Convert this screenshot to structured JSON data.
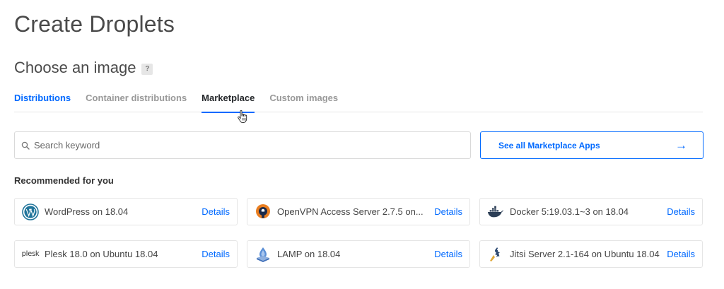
{
  "page": {
    "title": "Create Droplets"
  },
  "image_section": {
    "title": "Choose an image",
    "help_label": "?",
    "tabs": [
      {
        "label": "Distributions"
      },
      {
        "label": "Container distributions"
      },
      {
        "label": "Marketplace"
      },
      {
        "label": "Custom images"
      }
    ],
    "selected_tab": "Marketplace"
  },
  "search": {
    "placeholder": "Search keyword",
    "value": ""
  },
  "see_all": {
    "label": "See all Marketplace Apps",
    "icon": "arrow-right-icon"
  },
  "recommended": {
    "title": "Recommended for you",
    "details_label": "Details",
    "apps": [
      {
        "name": "WordPress on 18.04",
        "icon": "wordpress-icon"
      },
      {
        "name": "OpenVPN Access Server 2.7.5 on...",
        "icon": "openvpn-icon"
      },
      {
        "name": "Docker 5:19.03.1~3 on 18.04",
        "icon": "docker-icon"
      },
      {
        "name": "Plesk 18.0 on Ubuntu 18.04",
        "icon": "plesk-icon",
        "logo_text": "plesk"
      },
      {
        "name": "LAMP on 18.04",
        "icon": "lamp-icon"
      },
      {
        "name": "Jitsi Server 2.1-164 on Ubuntu 18.04",
        "icon": "jitsi-icon"
      }
    ]
  },
  "colors": {
    "accent": "#0069ff",
    "text_dark": "#24272a",
    "tab_muted": "#999999",
    "border": "#e5e5e5"
  }
}
